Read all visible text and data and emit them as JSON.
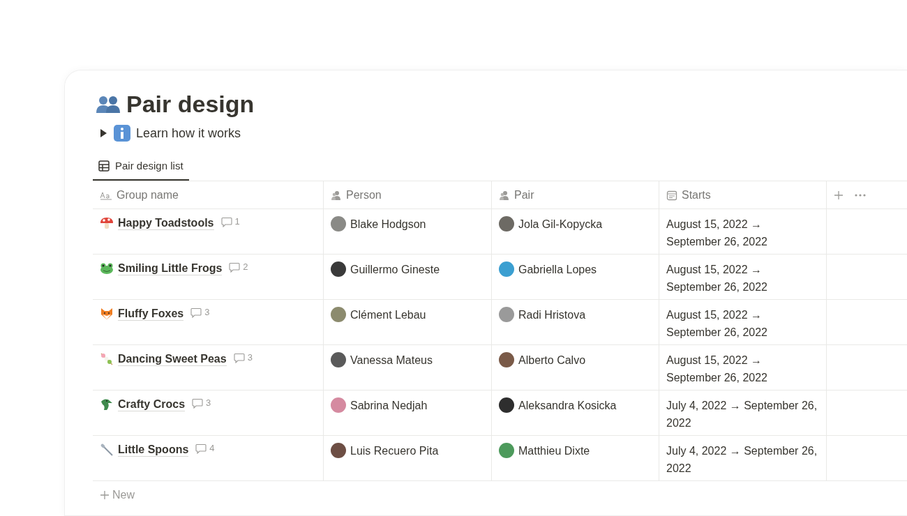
{
  "page": {
    "title": "Pair design"
  },
  "toggle": {
    "label": "Learn how it works",
    "expanded": false
  },
  "view_tab": {
    "label": "Pair design list",
    "selected": true
  },
  "table": {
    "columns": [
      {
        "label": "Group name",
        "kind": "title"
      },
      {
        "label": "Person",
        "kind": "person"
      },
      {
        "label": "Pair",
        "kind": "person"
      },
      {
        "label": "Starts",
        "kind": "date"
      }
    ],
    "rows": [
      {
        "group": "Happy Toadstools",
        "comments": "1",
        "person": "Blake Hodgson",
        "pair": "Jola Gil-Kopycka",
        "starts": "August 15, 2022 → September 26, 2022"
      },
      {
        "group": "Smiling Little Frogs",
        "comments": "2",
        "person": "Guillermo Gineste",
        "pair": "Gabriella Lopes",
        "starts": "August 15, 2022 → September 26, 2022"
      },
      {
        "group": "Fluffy Foxes",
        "comments": "3",
        "person": "Clément Lebau",
        "pair": "Radi Hristova",
        "starts": "August 15, 2022 → September 26, 2022"
      },
      {
        "group": "Dancing Sweet Peas",
        "comments": "3",
        "person": "Vanessa Mateus",
        "pair": "Alberto Calvo",
        "starts": "August 15, 2022 → September 26, 2022"
      },
      {
        "group": "Crafty Crocs",
        "comments": "3",
        "person": "Sabrina Nedjah",
        "pair": "Aleksandra Kosicka",
        "starts": "July 4, 2022 → September 26, 2022"
      },
      {
        "group": "Little Spoons",
        "comments": "4",
        "person": "Luis Recuero Pita",
        "pair": "Matthieu Dixte",
        "starts": "July 4, 2022 → September 26, 2022"
      }
    ]
  },
  "new_row": {
    "label": "New"
  }
}
